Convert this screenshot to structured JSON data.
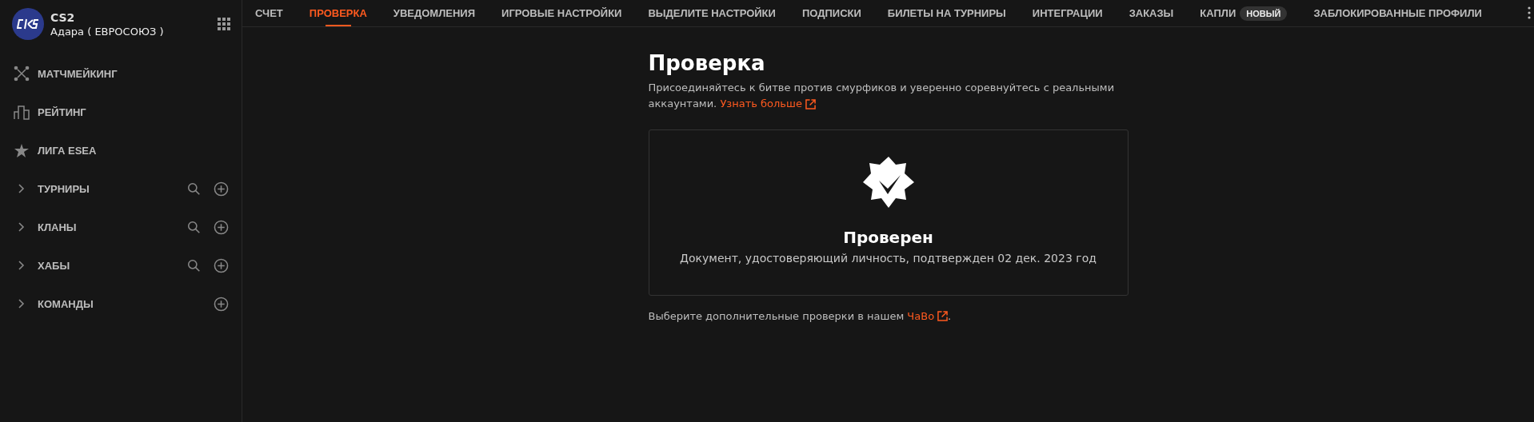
{
  "game": {
    "title": "CS2",
    "region": "Адара ( ЕВРОСОЮЗ )"
  },
  "sidebar": {
    "items": [
      {
        "kind": "link",
        "label": "МАТЧМЕЙКИНГ"
      },
      {
        "kind": "link",
        "label": "РЕЙТИНГ"
      },
      {
        "kind": "link",
        "label": "ЛИГА ESEA"
      },
      {
        "kind": "group",
        "label": "ТУРНИРЫ",
        "expanded": false,
        "search": true,
        "add": true
      },
      {
        "kind": "group",
        "label": "КЛАНЫ",
        "expanded": false,
        "search": true,
        "add": true
      },
      {
        "kind": "group",
        "label": "ХАБЫ",
        "expanded": false,
        "search": true,
        "add": true
      },
      {
        "kind": "group",
        "label": "КОМАНДЫ",
        "expanded": false,
        "search": false,
        "add": true
      }
    ]
  },
  "tabs": [
    {
      "label": "СЧЕТ",
      "selected": false
    },
    {
      "label": "ПРОВЕРКА",
      "selected": true
    },
    {
      "label": "УВЕДОМЛЕНИЯ",
      "selected": false
    },
    {
      "label": "ИГРОВЫЕ НАСТРОЙКИ",
      "selected": false
    },
    {
      "label": "ВЫДЕЛИТЕ НАСТРОЙКИ",
      "selected": false
    },
    {
      "label": "ПОДПИСКИ",
      "selected": false
    },
    {
      "label": "БИЛЕТЫ НА ТУРНИРЫ",
      "selected": false
    },
    {
      "label": "ИНТЕГРАЦИИ",
      "selected": false
    },
    {
      "label": "ЗАКАЗЫ",
      "selected": false
    },
    {
      "label": "КАПЛИ",
      "selected": false,
      "badge": "НОВЫЙ"
    },
    {
      "label": "ЗАБЛОКИРОВАННЫЕ ПРОФИЛИ",
      "selected": false
    }
  ],
  "page": {
    "title": "Проверка",
    "intro": "Присоединяйтесь к битве против смурфиков и уверенно соревнуйтесь с реальными аккаунтами.",
    "intro_link": "Узнать больше",
    "card": {
      "verified": true,
      "status": "Проверен",
      "detail": "Документ, удостоверяющий личность, подтвержден 02 дек. 2023 год"
    },
    "footer": "Выберите дополнительные проверки в нашем",
    "footer_link": "ЧаВо",
    "footer_end": "."
  }
}
